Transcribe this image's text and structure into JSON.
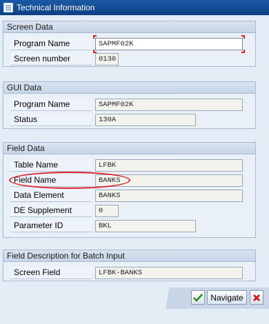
{
  "window": {
    "title": "Technical Information"
  },
  "screen_data": {
    "title": "Screen Data",
    "program_name_label": "Program Name",
    "program_name": "SAPMF02K",
    "screen_number_label": "Screen number",
    "screen_number": "0130"
  },
  "gui_data": {
    "title": "GUI Data",
    "program_name_label": "Program Name",
    "program_name": "SAPMF02K",
    "status_label": "Status",
    "status": "130A"
  },
  "field_data": {
    "title": "Field Data",
    "table_name_label": "Table Name",
    "table_name": "LFBK",
    "field_name_label": "Field Name",
    "field_name": "BANKS",
    "data_element_label": "Data Element",
    "data_element": "BANKS",
    "de_supplement_label": "DE Supplement",
    "de_supplement": "0",
    "parameter_id_label": "Parameter ID",
    "parameter_id": "BKL"
  },
  "batch_input": {
    "title": "Field Description for Batch Input",
    "screen_field_label": "Screen Field",
    "screen_field": "LFBK-BANKS"
  },
  "buttons": {
    "navigate_label": "Navigate"
  },
  "icons": {
    "confirm": "check-icon",
    "cancel": "cancel-icon",
    "window": "window-icon"
  },
  "colors": {
    "titlebar": "#1c5aa6",
    "highlight": "#e0202a"
  }
}
